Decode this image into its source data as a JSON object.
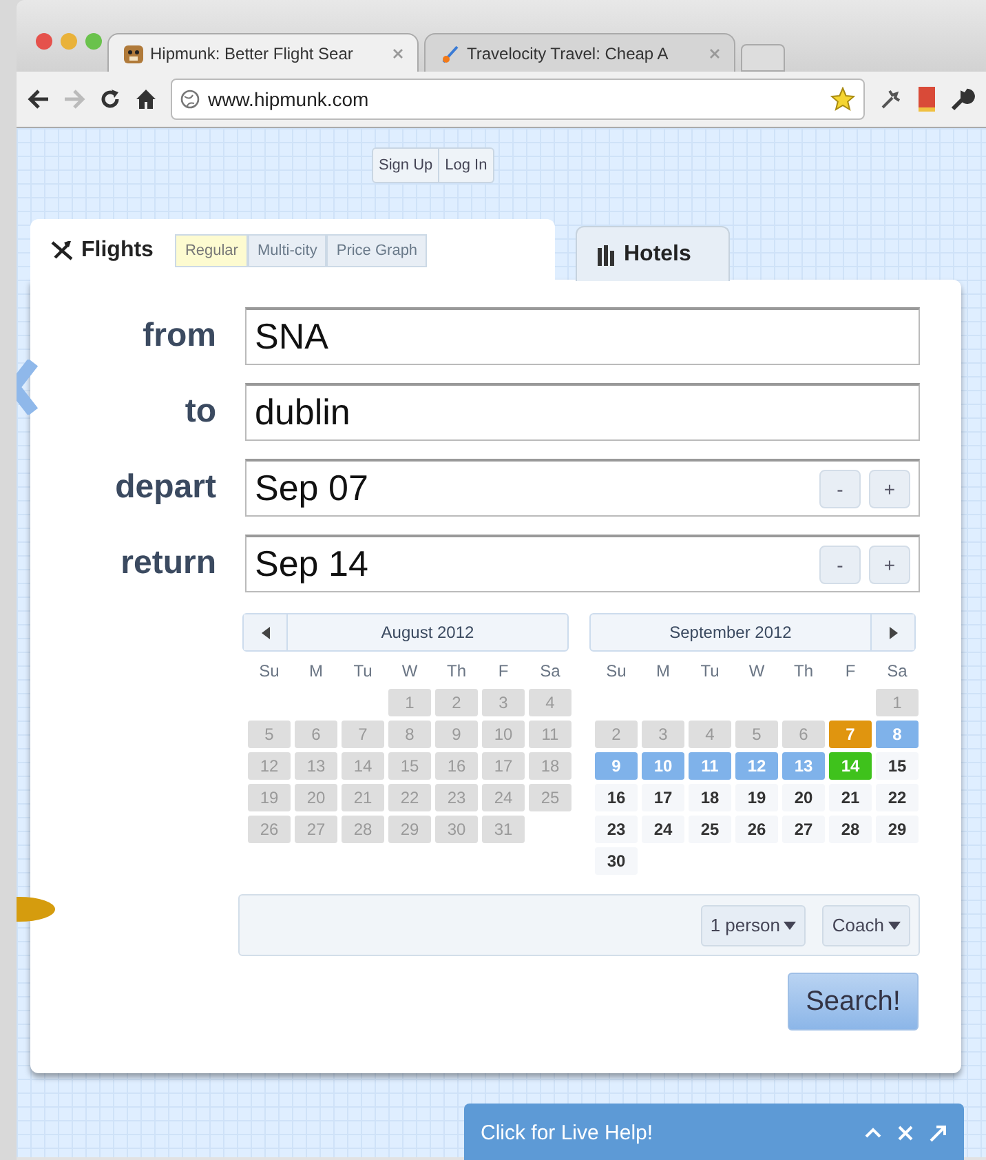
{
  "browser": {
    "tabs": [
      {
        "title": "Hipmunk: Better Flight Sear",
        "selected": true
      },
      {
        "title": "Travelocity Travel: Cheap A",
        "selected": false
      }
    ],
    "url": "www.hipmunk.com"
  },
  "account_buttons": [
    "Sign Up",
    "Log In"
  ],
  "search_tabs": [
    {
      "label": "Flights",
      "selected": true,
      "modes": [
        {
          "label": "Regular",
          "selected": true
        },
        {
          "label": "Multi-city",
          "selected": false
        },
        {
          "label": "Price Graph",
          "selected": false
        }
      ]
    },
    {
      "label": "Hotels",
      "selected": false
    }
  ],
  "fields": [
    {
      "label": "from",
      "value": "SNA"
    },
    {
      "label": "to",
      "value": "dublin"
    },
    {
      "label": "depart",
      "value": "Sep 07",
      "buttons": [
        "-",
        "+"
      ]
    },
    {
      "label": "return",
      "value": "Sep 14",
      "buttons": [
        "-",
        "+"
      ]
    }
  ],
  "calendars": [
    {
      "title": "August 2012",
      "prev_button": true,
      "weekdays": [
        "Su",
        "M",
        "Tu",
        "W",
        "Th",
        "F",
        "Sa"
      ],
      "weeks": [
        {
          "right_aligned": true,
          "days": [
            {
              "label": "1",
              "kind": "past"
            },
            {
              "label": "2",
              "kind": "past"
            },
            {
              "label": "3",
              "kind": "past"
            },
            {
              "label": "4",
              "kind": "past"
            }
          ]
        },
        {
          "days": [
            {
              "label": "5",
              "kind": "past"
            },
            {
              "label": "6",
              "kind": "past"
            },
            {
              "label": "7",
              "kind": "past"
            },
            {
              "label": "8",
              "kind": "past"
            },
            {
              "label": "9",
              "kind": "past"
            },
            {
              "label": "10",
              "kind": "past"
            },
            {
              "label": "11",
              "kind": "past"
            }
          ]
        },
        {
          "days": [
            {
              "label": "12",
              "kind": "past"
            },
            {
              "label": "13",
              "kind": "past"
            },
            {
              "label": "14",
              "kind": "past"
            },
            {
              "label": "15",
              "kind": "past"
            },
            {
              "label": "16",
              "kind": "past"
            },
            {
              "label": "17",
              "kind": "past"
            },
            {
              "label": "18",
              "kind": "past"
            }
          ]
        },
        {
          "days": [
            {
              "label": "19",
              "kind": "past"
            },
            {
              "label": "20",
              "kind": "past"
            },
            {
              "label": "21",
              "kind": "past"
            },
            {
              "label": "22",
              "kind": "past"
            },
            {
              "label": "23",
              "kind": "past"
            },
            {
              "label": "24",
              "kind": "past"
            },
            {
              "label": "25",
              "kind": "past"
            }
          ]
        },
        {
          "days": [
            {
              "label": "26",
              "kind": "past"
            },
            {
              "label": "27",
              "kind": "past"
            },
            {
              "label": "28",
              "kind": "past"
            },
            {
              "label": "29",
              "kind": "past"
            },
            {
              "label": "30",
              "kind": "past"
            },
            {
              "label": "31",
              "kind": "past"
            }
          ]
        }
      ]
    },
    {
      "title": "September 2012",
      "next_button": true,
      "weekdays": [
        "Su",
        "M",
        "Tu",
        "W",
        "Th",
        "F",
        "Sa"
      ],
      "weeks": [
        {
          "right_aligned": true,
          "days": [
            {
              "label": "1",
              "kind": "past"
            }
          ]
        },
        {
          "days": [
            {
              "label": "2",
              "kind": "past"
            },
            {
              "label": "3",
              "kind": "past"
            },
            {
              "label": "4",
              "kind": "past"
            },
            {
              "label": "5",
              "kind": "past"
            },
            {
              "label": "6",
              "kind": "past"
            },
            {
              "label": "7",
              "kind": "depart"
            },
            {
              "label": "8",
              "kind": "range"
            }
          ]
        },
        {
          "days": [
            {
              "label": "9",
              "kind": "range"
            },
            {
              "label": "10",
              "kind": "range"
            },
            {
              "label": "11",
              "kind": "range"
            },
            {
              "label": "12",
              "kind": "range"
            },
            {
              "label": "13",
              "kind": "range"
            },
            {
              "label": "14",
              "kind": "return"
            },
            {
              "label": "15",
              "kind": "open"
            }
          ]
        },
        {
          "days": [
            {
              "label": "16",
              "kind": "open"
            },
            {
              "label": "17",
              "kind": "open"
            },
            {
              "label": "18",
              "kind": "open"
            },
            {
              "label": "19",
              "kind": "open"
            },
            {
              "label": "20",
              "kind": "open"
            },
            {
              "label": "21",
              "kind": "open"
            },
            {
              "label": "22",
              "kind": "open"
            }
          ]
        },
        {
          "days": [
            {
              "label": "23",
              "kind": "open"
            },
            {
              "label": "24",
              "kind": "open"
            },
            {
              "label": "25",
              "kind": "open"
            },
            {
              "label": "26",
              "kind": "open"
            },
            {
              "label": "27",
              "kind": "open"
            },
            {
              "label": "28",
              "kind": "open"
            },
            {
              "label": "29",
              "kind": "open"
            }
          ]
        },
        {
          "days": [
            {
              "label": "30",
              "kind": "open"
            }
          ]
        }
      ]
    }
  ],
  "options": [
    "1 person",
    "Coach"
  ],
  "search_button": "Search!",
  "live_help": "Click for Live Help!"
}
